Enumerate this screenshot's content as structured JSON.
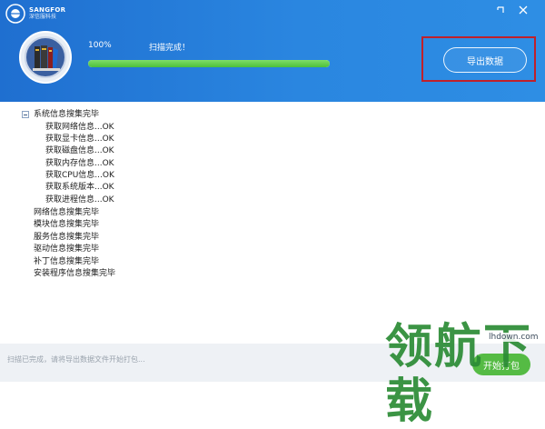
{
  "app": {
    "brand_name": "SANGFOR",
    "brand_sub": "深信服科技"
  },
  "window": {
    "restore_icon": "restore-icon",
    "close_icon": "close-icon"
  },
  "scan": {
    "percent_label": "100%",
    "progress": 1.0,
    "status": "扫描完成！",
    "emblem_icon": "scan-books-icon",
    "accent": "#2a86e0",
    "progress_color": "#5cc94a"
  },
  "export": {
    "label": "导出数据",
    "highlight_color": "#c0202a"
  },
  "tree": {
    "root": "系统信息搜集完毕",
    "children": [
      "获取网络信息...OK",
      "获取显卡信息...OK",
      "获取磁盘信息...OK",
      "获取内存信息...OK",
      "获取CPU信息...OK",
      "获取系统版本...OK",
      "获取进程信息...OK"
    ],
    "siblings": [
      "网络信息搜集完毕",
      "模块信息搜集完毕",
      "服务信息搜集完毕",
      "驱动信息搜集完毕",
      "补丁信息搜集完毕",
      "安装程序信息搜集完毕"
    ]
  },
  "footer": {
    "text": "扫描已完成，请将导出数据文件开始打包...",
    "open_label": "开始打包"
  },
  "watermark": {
    "text": "领航下载",
    "site": "lhdown.com"
  }
}
